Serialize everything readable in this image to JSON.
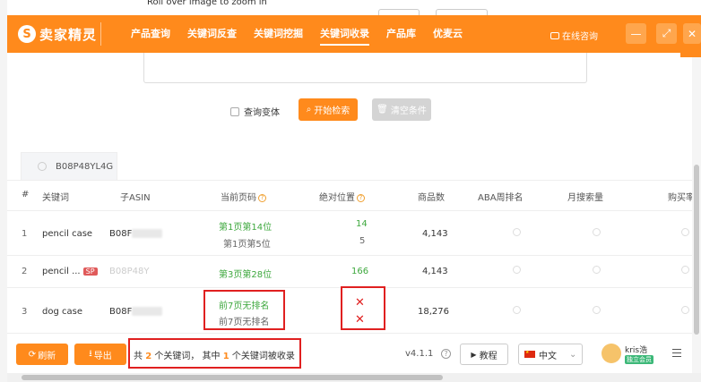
{
  "underlay": {
    "zoom_hint": "Roll over image to zoom in"
  },
  "header": {
    "logo_mark": "S",
    "logo_text": "卖家精灵",
    "nav": [
      "产品查询",
      "关键词反查",
      "关键词挖掘",
      "关键词收录",
      "产品库",
      "优麦云"
    ],
    "active_nav": "关键词收录",
    "consult": "在线咨询",
    "window_buttons": {
      "minimize": "—",
      "maximize": "⤢",
      "close": "✕"
    }
  },
  "search": {
    "variant_label": "查询变体",
    "search_button": "开始检索",
    "clear_button": "清空条件"
  },
  "tab": {
    "asin": "B08P48YL4G"
  },
  "table": {
    "columns": [
      "#",
      "关键词",
      "子ASIN",
      "当前页码",
      "绝对位置",
      "商品数",
      "ABA周排名",
      "月搜索量",
      "购买率"
    ],
    "rows": [
      {
        "index": "1",
        "keyword": "pencil case",
        "asin_prefix": "B08F",
        "page_primary": "第1页第14位",
        "page_secondary": "第1页第5位",
        "abs_primary": "14",
        "abs_secondary": "5",
        "products": "4,143"
      },
      {
        "index": "2",
        "keyword": "pencil ...",
        "sp_badge": "SP",
        "asin_prefix": "B08P48Y",
        "page_primary": "第3页第28位",
        "abs_primary": "166",
        "products": "4,143"
      },
      {
        "index": "3",
        "keyword": "dog case",
        "asin_prefix": "B08F",
        "page_primary": "前7页无排名",
        "page_secondary": "前7页无排名",
        "abs_primary": "✕",
        "abs_secondary": "✕",
        "products": "18,276"
      }
    ]
  },
  "bottom": {
    "refresh": "刷新",
    "export": "导出",
    "summary_prefix": "共",
    "summary_total": "2",
    "summary_mid": "个关键词， 其中",
    "summary_indexed": "1",
    "summary_suffix": "个关键词被收录",
    "version": "v4.1.1",
    "help": "?",
    "tutorial": "教程",
    "language": "中文",
    "user_name": "kris浩",
    "member_badge": "独立会员"
  },
  "colors": {
    "brand": "#ff8a1c",
    "rank_green": "#3ea83e",
    "highlight_red": "#e02020"
  }
}
